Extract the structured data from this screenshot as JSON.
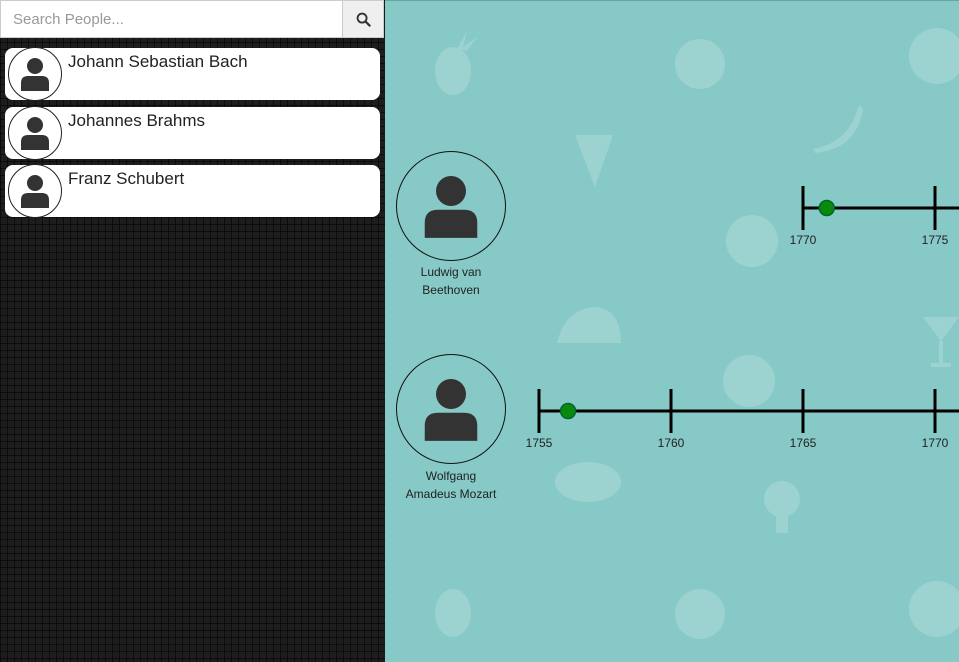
{
  "search": {
    "placeholder": "Search People..."
  },
  "icons": {
    "search": "search-icon",
    "person": "user-silhouette-icon"
  },
  "people_list": [
    {
      "name": "Johann Sebastian Bach"
    },
    {
      "name": "Johannes Brahms"
    },
    {
      "name": "Franz Schubert"
    }
  ],
  "timelines": [
    {
      "name": "Ludwig van Beethoven",
      "name_lines": [
        "Ludwig van",
        "Beethoven"
      ],
      "ticks": [
        "1770",
        "1775"
      ],
      "marker_year": 1770.9
    },
    {
      "name": "Wolfgang Amadeus Mozart",
      "name_lines": [
        "Wolfgang",
        "Amadeus Mozart"
      ],
      "ticks": [
        "1755",
        "1760",
        "1765",
        "1770"
      ],
      "marker_year": 1756.1
    }
  ],
  "colors": {
    "sidebar_bg": "#1d1d1d",
    "timeline_bg": "#86c9c6",
    "marker": "#0a8a0a"
  }
}
